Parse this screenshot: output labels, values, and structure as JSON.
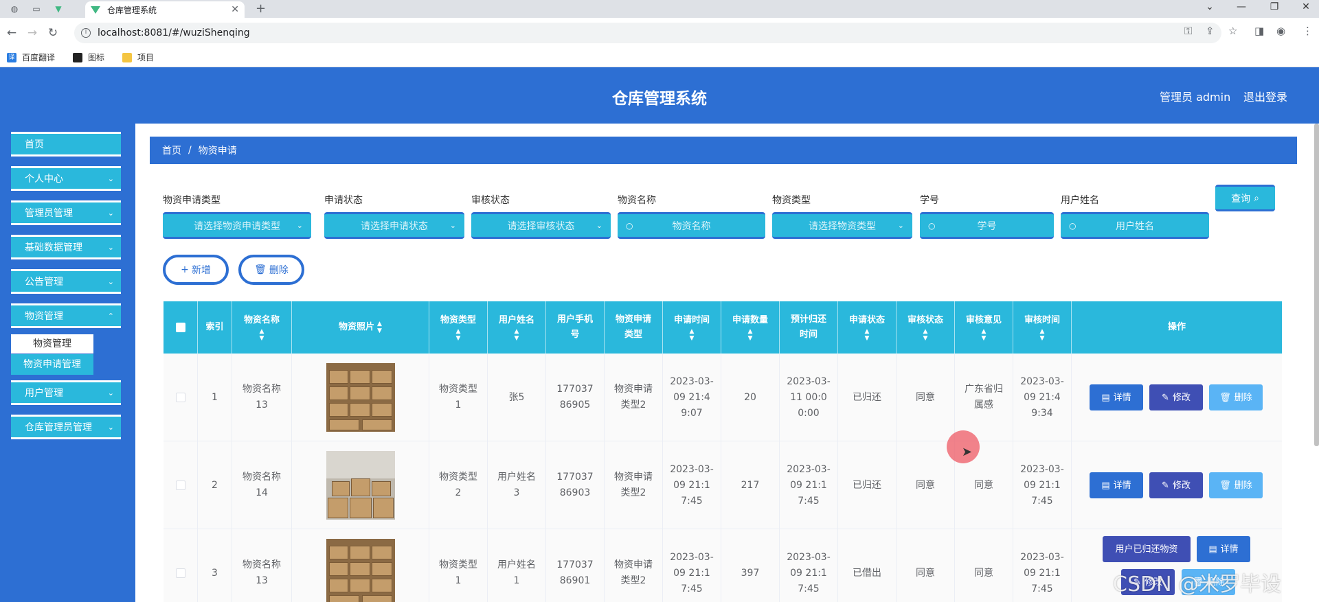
{
  "browser": {
    "tab_title": "仓库管理系统",
    "url": "localhost:8081/#/wuziShenqing",
    "bookmarks": [
      {
        "label": "百度翻译",
        "icon": "translate-icon",
        "color": "#2a7de1"
      },
      {
        "label": "图标",
        "icon": "folder-dark-icon",
        "color": "#222222"
      },
      {
        "label": "项目",
        "icon": "folder-icon",
        "color": "#f4c542"
      }
    ]
  },
  "header": {
    "title": "仓库管理系统",
    "admin_label": "管理员 admin",
    "logout_label": "退出登录"
  },
  "sidebar": {
    "items": [
      {
        "label": "首页",
        "expandable": false
      },
      {
        "label": "个人中心",
        "expandable": true
      },
      {
        "label": "管理员管理",
        "expandable": true
      },
      {
        "label": "基础数据管理",
        "expandable": true
      },
      {
        "label": "公告管理",
        "expandable": true
      },
      {
        "label": "物资管理",
        "expandable": true
      },
      {
        "label": "用户管理",
        "expandable": true
      },
      {
        "label": "仓库管理员管理",
        "expandable": true
      }
    ],
    "submenu": [
      "物资管理",
      "物资申请管理"
    ]
  },
  "breadcrumb": {
    "home": "首页",
    "separator": "/",
    "current": "物资申请"
  },
  "filters": [
    {
      "label": "物资申请类型",
      "placeholder": "请选择物资申请类型",
      "kind": "select"
    },
    {
      "label": "申请状态",
      "placeholder": "请选择申请状态",
      "kind": "select"
    },
    {
      "label": "审核状态",
      "placeholder": "请选择审核状态",
      "kind": "select"
    },
    {
      "label": "物资名称",
      "placeholder": "物资名称",
      "kind": "input"
    },
    {
      "label": "物资类型",
      "placeholder": "请选择物资类型",
      "kind": "select"
    },
    {
      "label": "学号",
      "placeholder": "学号",
      "kind": "input"
    },
    {
      "label": "用户姓名",
      "placeholder": "用户姓名",
      "kind": "input"
    }
  ],
  "buttons": {
    "query": "查询",
    "add": "新增",
    "delete": "删除"
  },
  "table": {
    "headers": [
      "索引",
      "物资名称",
      "物资照片",
      "物资类型",
      "用户姓名",
      "用户手机号",
      "物资申请类型",
      "申请时间",
      "申请数量",
      "预计归还时间",
      "申请状态",
      "审核状态",
      "审核意见",
      "审核时间",
      "操作"
    ],
    "rows": [
      {
        "index": "1",
        "name": "物资名称13",
        "type": "物资类型1",
        "user": "张5",
        "phone": "17703786905",
        "apply_type": "物资申请类型2",
        "apply_time": "2023-03-09 21:49:07",
        "qty": "20",
        "return_time": "2023-03-11 00:00:00",
        "apply_status": "已归还",
        "review_status": "同意",
        "review_opinion": "广东省归属感",
        "review_time": "2023-03-09 21:49:34",
        "actions": [
          "详情",
          "修改",
          "删除"
        ]
      },
      {
        "index": "2",
        "name": "物资名称14",
        "type": "物资类型2",
        "user": "用户姓名3",
        "phone": "17703786903",
        "apply_type": "物资申请类型2",
        "apply_time": "2023-03-09 21:17:45",
        "qty": "217",
        "return_time": "2023-03-09 21:17:45",
        "apply_status": "已归还",
        "review_status": "同意",
        "review_opinion": "同意",
        "review_time": "2023-03-09 21:17:45",
        "actions": [
          "详情",
          "修改",
          "删除"
        ]
      },
      {
        "index": "3",
        "name": "物资名称13",
        "type": "物资类型1",
        "user": "用户姓名1",
        "phone": "17703786901",
        "apply_type": "物资申请类型2",
        "apply_time": "2023-03-09 21:17:45",
        "qty": "397",
        "return_time": "2023-03-09 21:17:45",
        "apply_status": "已借出",
        "review_status": "同意",
        "review_opinion": "同意",
        "review_time": "2023-03-09 21:17:45",
        "actions": [
          "用户已归还物资",
          "详情",
          "修改",
          "删除"
        ]
      }
    ]
  },
  "watermark": "CSDN @米罗毕设",
  "colors": {
    "header_blue": "#2d6fd3",
    "cyan": "#2ab8dc",
    "detail_btn": "#2d6fd3",
    "edit_btn": "#3f4fb4",
    "delete_btn": "#5ab4f5"
  }
}
